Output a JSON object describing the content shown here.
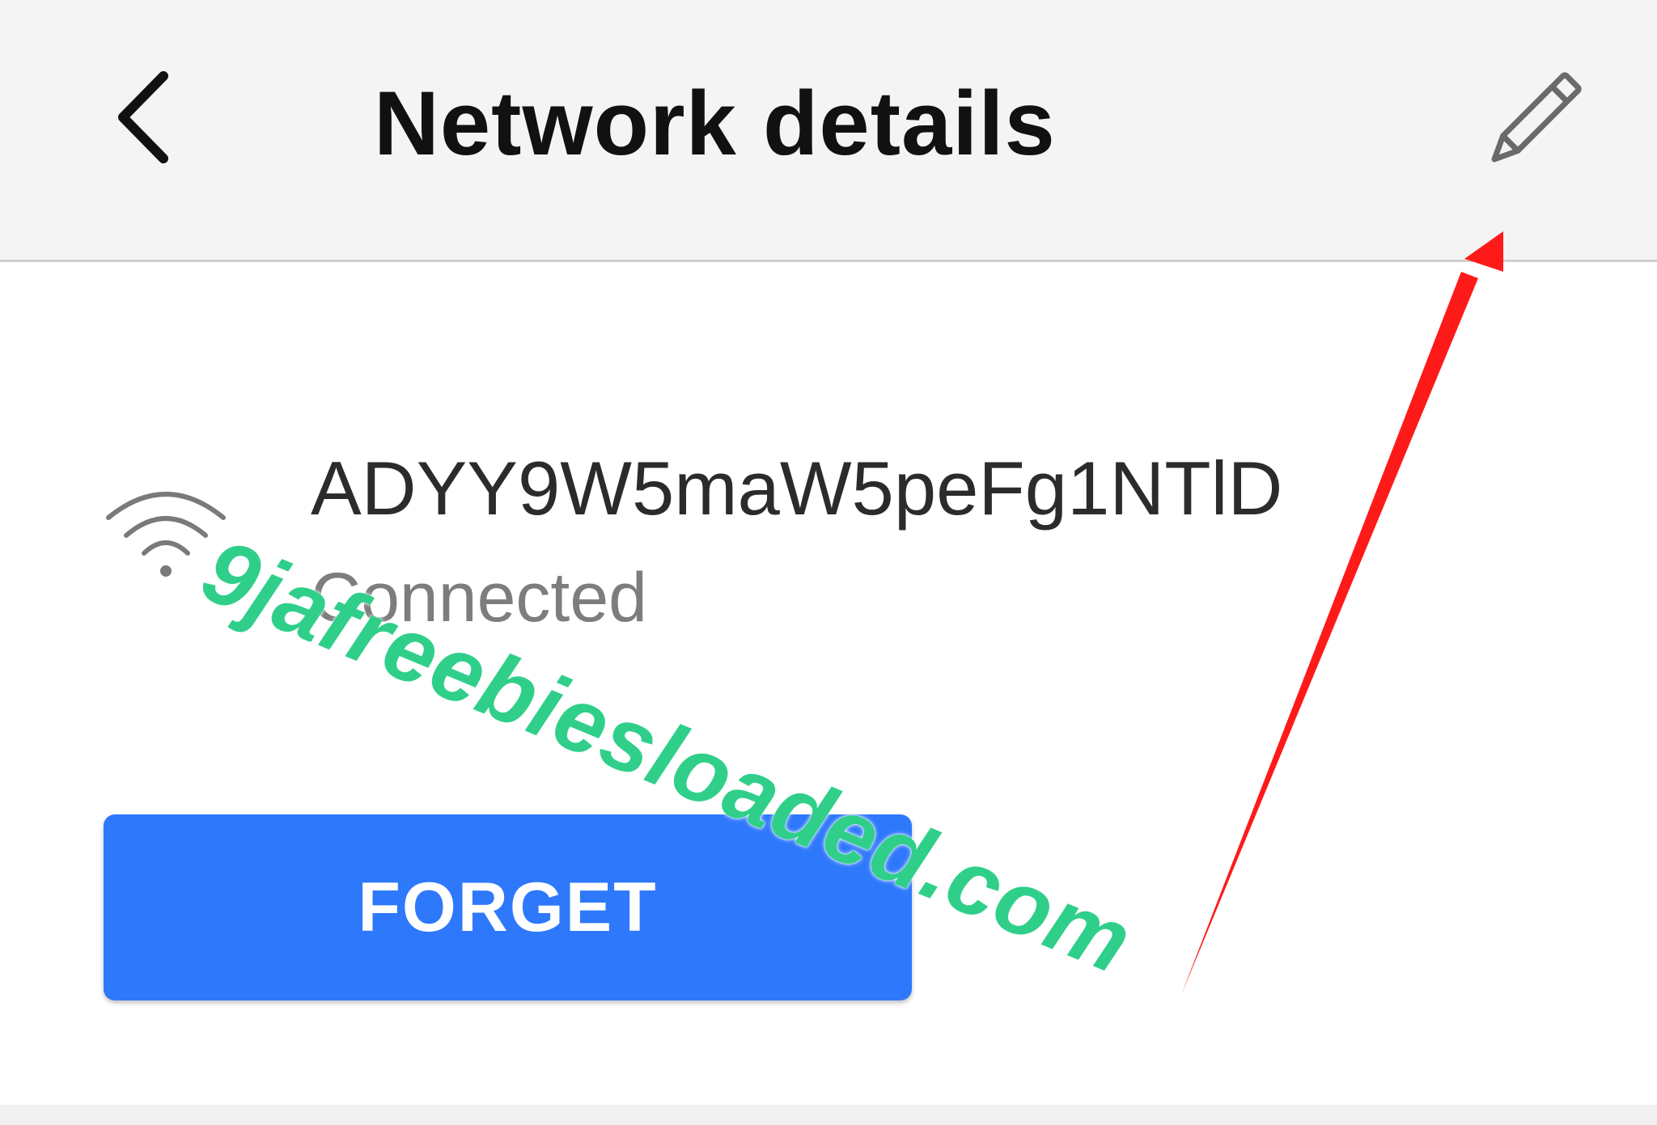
{
  "header": {
    "title": "Network details",
    "back_icon": "chevron-left-icon",
    "edit_icon": "pencil-icon"
  },
  "network": {
    "ssid": "ADYY9W5maW5peFg1NTlD",
    "status": "Connected",
    "icon": "wifi-icon"
  },
  "actions": {
    "forget_label": "FORGET"
  },
  "overlay": {
    "watermark": "9jafreebiesloaded.com",
    "annotation": "arrow pointing to edit icon"
  },
  "colors": {
    "header_bg": "#f4f4f4",
    "accent": "#2e78fb",
    "watermark": "#2fcf8a",
    "arrow": "#ff1a1a",
    "status_text": "#7d7d7d"
  }
}
